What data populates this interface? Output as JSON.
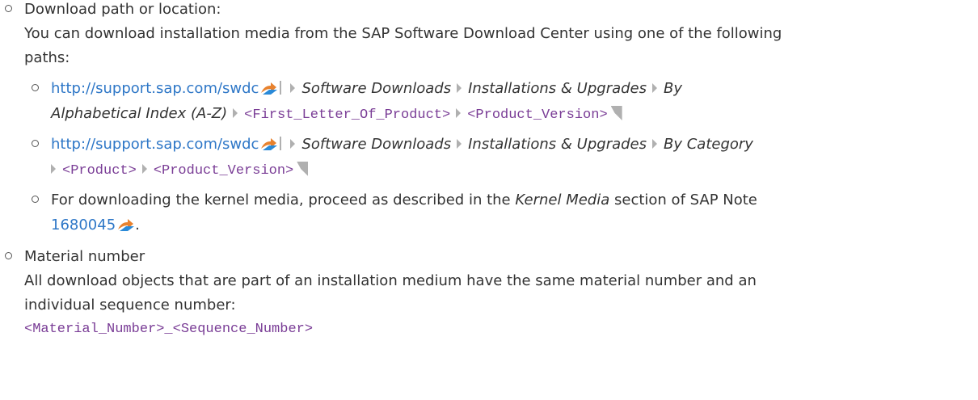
{
  "items": {
    "download": {
      "heading": "Download path or location:",
      "para1": "You can download installation media from the SAP Software Download Center using one of the following",
      "para2": "paths:",
      "path1": {
        "url": "http://support.sap.com/swdc",
        "seg1": "Software Downloads",
        "seg2": "Installations & Upgrades",
        "seg3": "By",
        "seg4": "Alphabetical Index (A-Z)",
        "code1": "<First_Letter_Of_Product>",
        "code2": "<Product_Version>"
      },
      "path2": {
        "url": "http://support.sap.com/swdc",
        "seg1": "Software Downloads",
        "seg2": "Installations & Upgrades",
        "seg3": "By Category",
        "code1": "<Product>",
        "code2": "<Product_Version>"
      },
      "kernel": {
        "pre": "For downloading the kernel media, proceed as described in the",
        "em": "Kernel Media",
        "post": "section of SAP Note",
        "note": "1680045",
        "end": "."
      }
    },
    "material": {
      "heading": "Material number",
      "para1": "All download objects that are part of an installation medium have the same material number and an",
      "para2": "individual sequence number:",
      "code": "<Material_Number>_<Sequence_Number>"
    }
  },
  "icons": {
    "bullet": "hollow-circle-bullet",
    "external_link": "external-link-icon",
    "path_separator": "chevron-right-icon",
    "path_end": "path-end-marker-icon"
  },
  "colors": {
    "text": "#333333",
    "link": "#2e77c7",
    "code": "#7a3d96",
    "icon_orange": "#e8822e",
    "icon_blue": "#2a8ad8"
  }
}
